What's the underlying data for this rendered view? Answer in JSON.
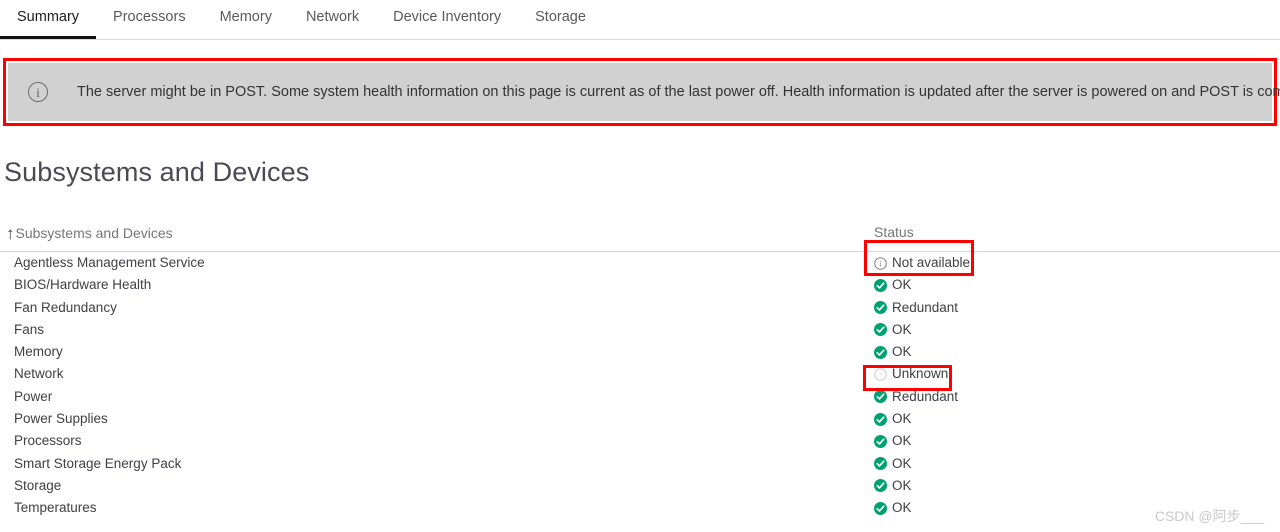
{
  "tabs": [
    {
      "label": "Summary",
      "active": true
    },
    {
      "label": "Processors",
      "active": false
    },
    {
      "label": "Memory",
      "active": false
    },
    {
      "label": "Network",
      "active": false
    },
    {
      "label": "Device Inventory",
      "active": false
    },
    {
      "label": "Storage",
      "active": false
    }
  ],
  "alert": {
    "icon": "info-circle-icon",
    "glyph": "i",
    "text": "The server might be in POST. Some system health information on this page is current as of the last power off. Health information is updated after the server is powered on and POST is complete."
  },
  "page": {
    "title": "Subsystems and Devices"
  },
  "table": {
    "sort_arrow": "↑",
    "columns": [
      "Subsystems and Devices",
      "Status"
    ],
    "rows": [
      {
        "name": "Agentless Management Service",
        "status": "Not available",
        "icon": "info-circle-icon",
        "state": "notavailable"
      },
      {
        "name": "BIOS/Hardware Health",
        "status": "OK",
        "icon": "check-circle-icon",
        "state": "ok"
      },
      {
        "name": "Fan Redundancy",
        "status": "Redundant",
        "icon": "check-circle-icon",
        "state": "ok"
      },
      {
        "name": "Fans",
        "status": "OK",
        "icon": "check-circle-icon",
        "state": "ok"
      },
      {
        "name": "Memory",
        "status": "OK",
        "icon": "check-circle-icon",
        "state": "ok"
      },
      {
        "name": "Network",
        "status": "Unknown",
        "icon": "question-circle-icon",
        "state": "unknown"
      },
      {
        "name": "Power",
        "status": "Redundant",
        "icon": "check-circle-icon",
        "state": "ok"
      },
      {
        "name": "Power Supplies",
        "status": "OK",
        "icon": "check-circle-icon",
        "state": "ok"
      },
      {
        "name": "Processors",
        "status": "OK",
        "icon": "check-circle-icon",
        "state": "ok"
      },
      {
        "name": "Smart Storage Energy Pack",
        "status": "OK",
        "icon": "check-circle-icon",
        "state": "ok"
      },
      {
        "name": "Storage",
        "status": "OK",
        "icon": "check-circle-icon",
        "state": "ok"
      },
      {
        "name": "Temperatures",
        "status": "OK",
        "icon": "check-circle-icon",
        "state": "ok"
      }
    ]
  },
  "annotations": [
    {
      "name": "annotation-box-not-available",
      "target": "Not available"
    },
    {
      "name": "annotation-box-unknown",
      "target": "Unknown"
    }
  ],
  "watermark": {
    "text": "CSDN @阿步___"
  },
  "colors": {
    "status_ok": "#00a170",
    "status_unknown_icon": "#cfcfcf",
    "status_notavailable_icon": "#8a8a8a",
    "annotation": "#ff0000",
    "alert_bg": "#d1d1d1",
    "active_tab_underline": "#111111"
  }
}
